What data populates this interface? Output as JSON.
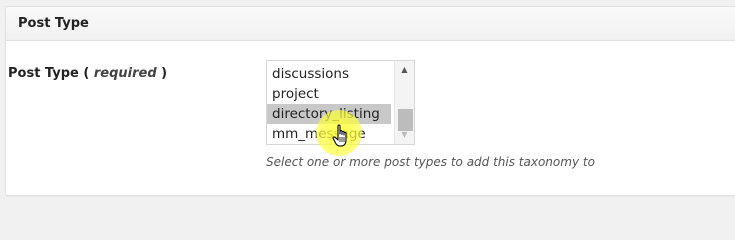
{
  "metabox": {
    "title": "Post Type"
  },
  "field": {
    "label": "Post Type",
    "required_open": " ( ",
    "required_text": "required",
    "required_close": " )",
    "options": [
      {
        "label": "discussions",
        "selected": false
      },
      {
        "label": "project",
        "selected": false
      },
      {
        "label": "directory_listing",
        "selected": true
      },
      {
        "label": "mm_message",
        "selected": false
      }
    ],
    "hint": "Select one or more post types to add this taxonomy to"
  },
  "icons": {
    "scroll_up": "triangle-up-icon",
    "scroll_down": "triangle-down-icon",
    "cursor": "hand-pointer-icon"
  },
  "colors": {
    "selected_bg": "#c8c8c8",
    "highlight": "#ffff33"
  }
}
